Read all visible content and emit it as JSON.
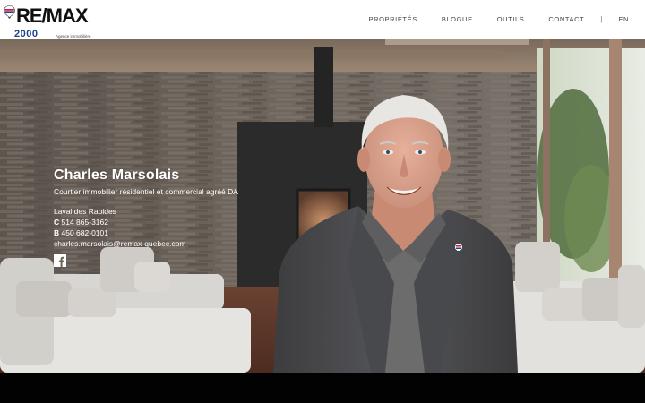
{
  "brand": {
    "name": "RE/MAX",
    "sub": "2000",
    "tagline": "Agence immobilière",
    "colors": {
      "red": "#dc1c2e",
      "blue": "#1f3f8f"
    }
  },
  "nav": {
    "items": [
      {
        "label": "PROPRIÉTÉS"
      },
      {
        "label": "BLOGUE"
      },
      {
        "label": "OUTILS"
      },
      {
        "label": "CONTACT"
      }
    ],
    "separator": "|",
    "language": "EN"
  },
  "agent": {
    "name": "Charles Marsolais",
    "title": "Courtier immobilier résidentiel et commercial agréé DA",
    "office": "Laval des Rapides",
    "cell_prefix": "C",
    "cell": "514 865-3162",
    "office_prefix": "B",
    "office_phone": "450 682-0101",
    "email": "charles.marsolais@remax-quebec.com",
    "social_icon": "facebook-icon"
  }
}
